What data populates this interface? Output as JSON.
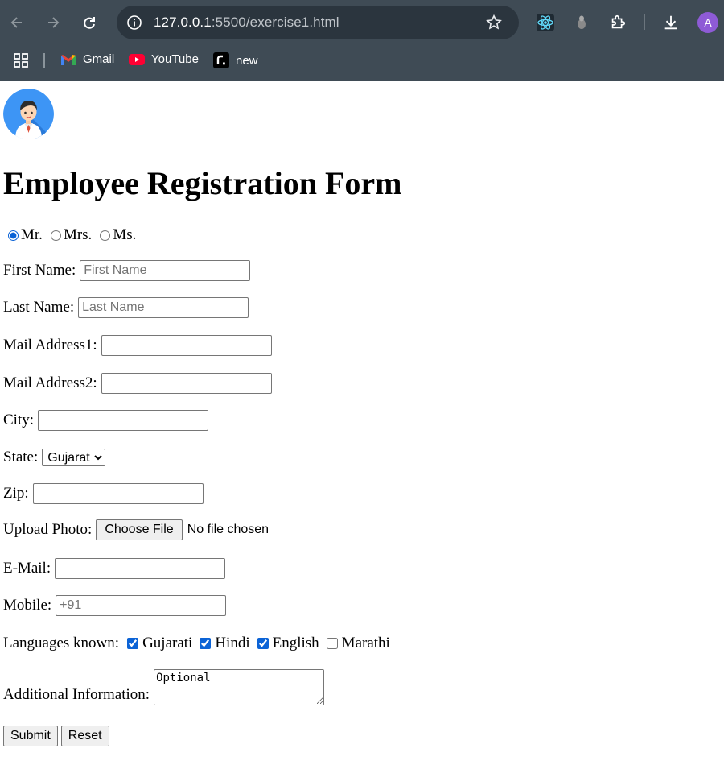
{
  "browser": {
    "url_host": "127.0.0.1",
    "url_path": ":5500/exercise1.html",
    "profile_initial": "A",
    "bookmarks": [
      {
        "label": "Gmail",
        "icon": "gmail-icon"
      },
      {
        "label": "YouTube",
        "icon": "youtube-icon"
      },
      {
        "label": "new",
        "icon": "new-icon"
      }
    ]
  },
  "form": {
    "title": "Employee Registration Form",
    "salutations": [
      "Mr.",
      "Mrs.",
      "Ms."
    ],
    "salutation_selected": "Mr.",
    "first_name": {
      "label": "First Name:",
      "placeholder": "First Name",
      "value": ""
    },
    "last_name": {
      "label": "Last Name:",
      "placeholder": "Last Name",
      "value": ""
    },
    "mail1": {
      "label": "Mail Address1:",
      "value": ""
    },
    "mail2": {
      "label": "Mail Address2:",
      "value": ""
    },
    "city": {
      "label": "City:",
      "value": ""
    },
    "state": {
      "label": "State:",
      "selected": "Gujarat"
    },
    "zip": {
      "label": "Zip:",
      "value": ""
    },
    "photo": {
      "label": "Upload Photo:",
      "button": "Choose File",
      "status": "No file chosen"
    },
    "email": {
      "label": "E-Mail:",
      "value": ""
    },
    "mobile": {
      "label": "Mobile:",
      "placeholder": "+91",
      "value": ""
    },
    "languages": {
      "label": "Languages known:",
      "options": [
        {
          "name": "Gujarati",
          "checked": true
        },
        {
          "name": "Hindi",
          "checked": true
        },
        {
          "name": "English",
          "checked": true
        },
        {
          "name": "Marathi",
          "checked": false
        }
      ]
    },
    "additional": {
      "label": "Additional Information:",
      "placeholder": "Optional"
    },
    "submit_label": "Submit",
    "reset_label": "Reset"
  },
  "colors": {
    "chrome": "#3f4b55",
    "omnibox": "#2b353e",
    "accent": "#0b63d6",
    "profile": "#8e5bd6"
  }
}
